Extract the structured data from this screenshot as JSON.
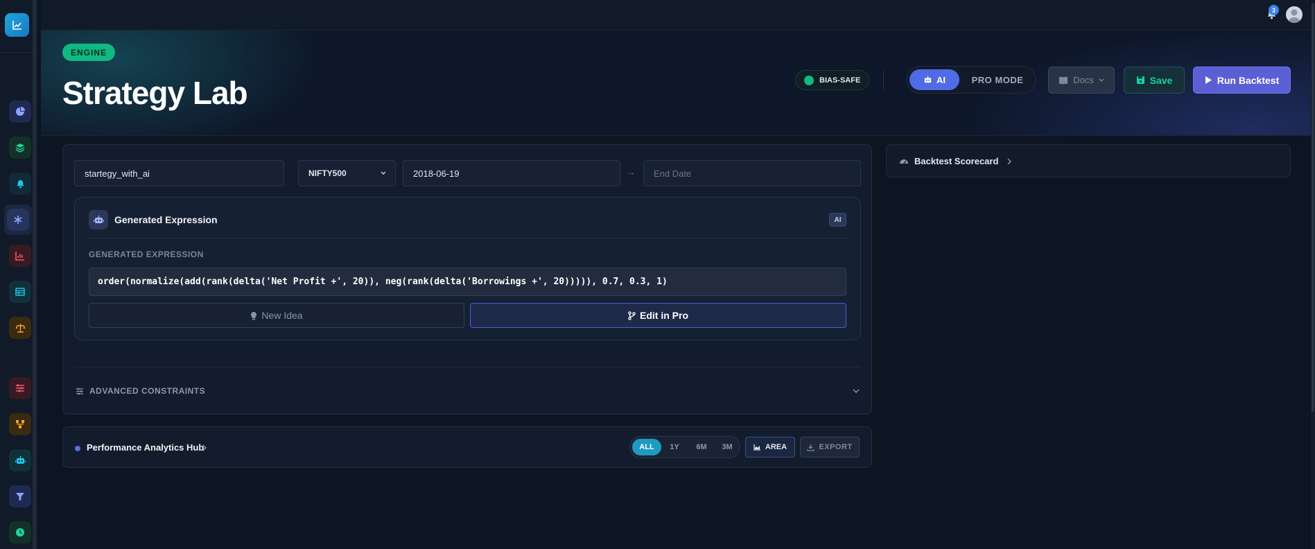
{
  "notifications": {
    "count": "3"
  },
  "hero": {
    "badge": "ENGINE",
    "title": "Strategy Lab",
    "bias_label": "BIAS-SAFE",
    "mode_ai": "AI",
    "mode_pro": "PRO MODE",
    "docs_label": "Docs",
    "save_label": "Save",
    "run_label": "Run Backtest"
  },
  "form": {
    "strategy_name": "startegy_with_ai",
    "universe": "NIFTY500",
    "start_date": "2018-06-19",
    "end_date_placeholder": "End Date",
    "date_arrow": "→"
  },
  "generated": {
    "title": "Generated Expression",
    "ai_tag": "AI",
    "label": "GENERATED EXPRESSION",
    "expression": "order(normalize(add(rank(delta('Net Profit +', 20)), neg(rank(delta('Borrowings +', 20))))), 0.7, 0.3, 1)",
    "new_idea_label": "New Idea",
    "edit_pro_label": "Edit in Pro"
  },
  "advanced": {
    "label": "ADVANCED CONSTRAINTS"
  },
  "performance": {
    "title": "Performance Analytics Hub",
    "ranges": [
      "ALL",
      "1Y",
      "6M",
      "3M"
    ],
    "active_range": "ALL",
    "area_label": "AREA",
    "export_label": "EXPORT"
  },
  "scorecard": {
    "title": "Backtest Scorecard"
  },
  "sidebar": {
    "icons": [
      "dashboard-icon",
      "layers-icon",
      "bell-icon",
      "asterisk-icon",
      "chart-icon",
      "table-icon",
      "scale-icon",
      "sliders-icon",
      "workflow-icon",
      "robot-icon",
      "filter-icon",
      "clock-icon"
    ],
    "active": "asterisk-icon"
  },
  "colors": {
    "accent": "#4f6be6",
    "success": "#10b981",
    "run": "#5a5fd6",
    "range_active": "#1e9bc2"
  }
}
